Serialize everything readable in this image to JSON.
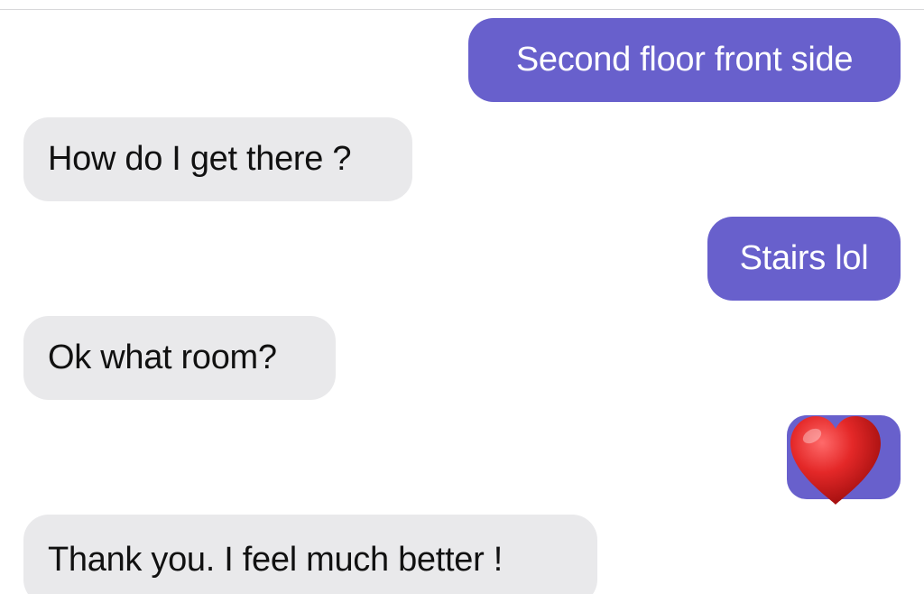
{
  "conversation": {
    "messages": [
      {
        "direction": "outgoing",
        "text": "Second floor front side"
      },
      {
        "direction": "incoming",
        "text": "How do I get there ?"
      },
      {
        "direction": "outgoing",
        "text": "Stairs lol"
      },
      {
        "direction": "incoming",
        "text": "Ok what room?"
      },
      {
        "direction": "outgoing",
        "emoji": "red-heart",
        "text": ""
      },
      {
        "direction": "incoming",
        "text": "Thank you.  I feel much better !"
      }
    ]
  },
  "colors": {
    "outgoing_bubble": "#6860cc",
    "incoming_bubble": "#e9e9eb",
    "heart": "#d81e1e"
  }
}
